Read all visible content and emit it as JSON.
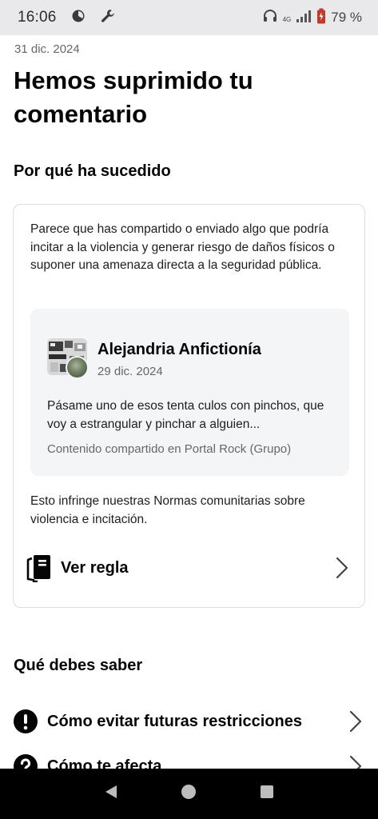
{
  "status_bar": {
    "time": "16:06",
    "network": "4G",
    "battery": "79 %",
    "icons": [
      "pie-timer-icon",
      "wrench-icon",
      "headphones-icon",
      "signal-icon",
      "battery-icon"
    ]
  },
  "header": {
    "date": "31 dic. 2024",
    "title": "Hemos suprimido tu comentario"
  },
  "why": {
    "heading": "Por qué ha sucedido",
    "explanation": "Parece que has compartido o enviado algo que podría incitar a la violencia y generar riesgo de daños físicos o suponer una amenaza directa a la seguridad pública.",
    "post": {
      "author": "Alejandria Anfictionía",
      "date": "29 dic. 2024",
      "body": "Pásame uno de esos tenta culos con pinchos, que voy a estrangular y pinchar a alguien...",
      "shared_in": "Contenido compartido en Portal Rock (Grupo)"
    },
    "violation": "Esto infringe nuestras Normas comunitarias sobre violencia e incitación.",
    "view_rule_label": "Ver regla"
  },
  "know": {
    "heading": "Qué debes saber",
    "items": [
      {
        "label": "Cómo evitar futuras restricciones",
        "icon": "exclamation-circle-icon"
      },
      {
        "label": "Cómo te afecta",
        "icon": "question-circle-icon"
      }
    ]
  },
  "nav": {
    "buttons": [
      "back-button",
      "home-button",
      "recents-button"
    ]
  }
}
